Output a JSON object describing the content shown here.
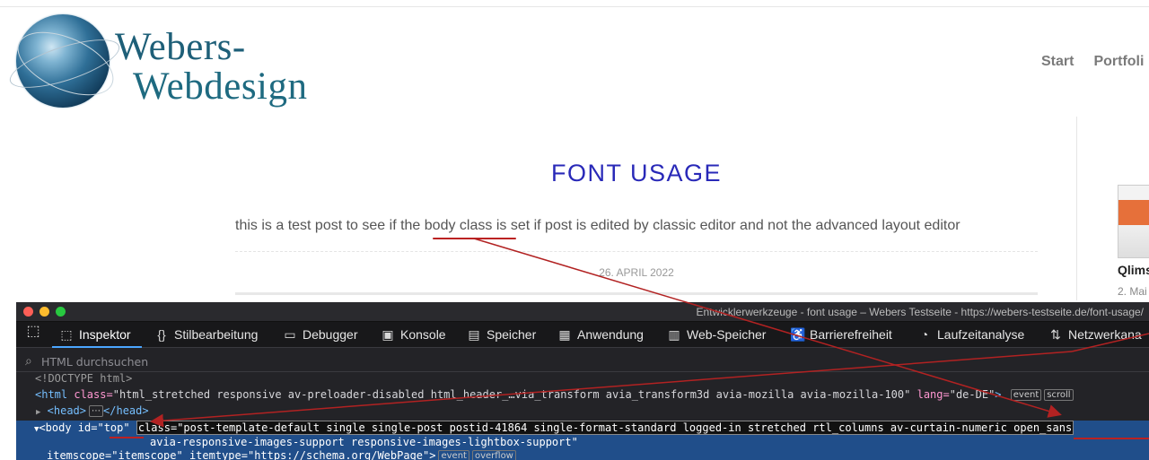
{
  "site": {
    "logo": {
      "line1": "Webers-",
      "line2": "Webdesign"
    },
    "nav": [
      "Start",
      "Portfoli"
    ],
    "sidebar": {
      "post_title": "Qlims",
      "post_date": "2. Mai"
    }
  },
  "post": {
    "title": "FONT USAGE",
    "body": "this is a test post to see if the body class is set if post is edited by classic editor and not the advanced layout editor",
    "date": "26. APRIL 2022"
  },
  "devtools": {
    "window_title": "Entwicklerwerkzeuge - font usage – Webers Testseite - https://webers-testseite.de/font-usage/",
    "tabs": [
      {
        "label": "Inspektor",
        "icon": "inspector-icon"
      },
      {
        "label": "Stilbearbeitung",
        "icon": "braces-icon"
      },
      {
        "label": "Debugger",
        "icon": "debugger-icon"
      },
      {
        "label": "Konsole",
        "icon": "console-icon"
      },
      {
        "label": "Speicher",
        "icon": "memory-icon"
      },
      {
        "label": "Anwendung",
        "icon": "grid-icon"
      },
      {
        "label": "Web-Speicher",
        "icon": "storage-icon"
      },
      {
        "label": "Barrierefreiheit",
        "icon": "accessibility-icon"
      },
      {
        "label": "Laufzeitanalyse",
        "icon": "gauge-icon"
      },
      {
        "label": "Netzwerkana",
        "icon": "network-icon"
      }
    ],
    "search_placeholder": "HTML durchsuchen",
    "tree": {
      "doctype": "<!DOCTYPE html>",
      "html_open": "<html",
      "html_class_attr": "class=",
      "html_class_val": "\"html_stretched responsive av-preloader-disabled html_header_…via_transform avia_transform3d avia-mozilla avia-mozilla-100\"",
      "html_lang_attr": "lang=",
      "html_lang_val": "\"de-DE\"",
      "html_close": ">",
      "html_pills": [
        "event",
        "scroll"
      ],
      "head_open": "<head>",
      "head_pill": "⋯",
      "head_close": "</head>",
      "body_open": "<body",
      "body_id_attr": "id=",
      "body_id_val": "\"top\"",
      "body_class_attr": "class=",
      "body_class_val_1": "\"post-template-default single single-post postid-41864 single-format-standard logged-in stretched rtl_columns av-curtain-numeric open_sans",
      "body_class_val_2": "avia-responsive-images-support responsive-images-lightbox-support\"",
      "body_line3": "itemscope=\"itemscope\" itemtype=\"https://schema.org/WebPage\">",
      "body_pills": [
        "event",
        "overflow"
      ]
    }
  },
  "colors": {
    "title_blue": "#2929b8",
    "annotation_red": "#b22222",
    "devtools_bg": "#232327",
    "selection_blue": "#204e8a"
  }
}
